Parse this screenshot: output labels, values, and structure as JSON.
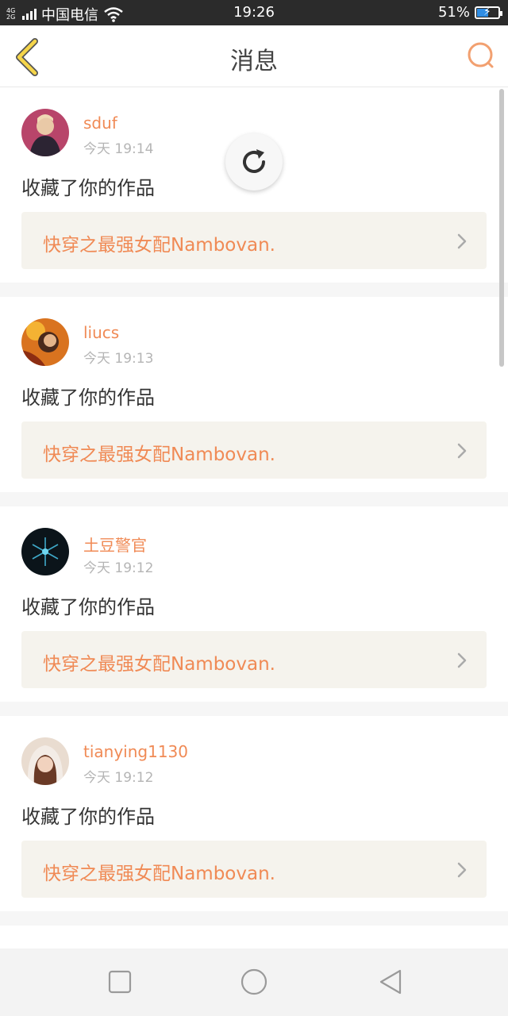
{
  "status_bar": {
    "network_top": "4G",
    "network_bottom": "2G",
    "carrier": "中国电信",
    "time": "19:26",
    "battery": "51%",
    "battery_level": 0.51
  },
  "header": {
    "title": "消息"
  },
  "messages": [
    {
      "username": "sduf",
      "time": "今天 19:14",
      "action": "收藏了你的作品",
      "work": "快穿之最强女配Nambovan.",
      "avatar_color": "#7a3b4a"
    },
    {
      "username": "liucs",
      "time": "今天 19:13",
      "action": "收藏了你的作品",
      "work": "快穿之最强女配Nambovan.",
      "avatar_color": "#c8651e"
    },
    {
      "username": "土豆警官",
      "time": "今天 19:12",
      "action": "收藏了你的作品",
      "work": "快穿之最强女配Nambovan.",
      "avatar_color": "#0e1a22"
    },
    {
      "username": "tianying1130",
      "time": "今天 19:12",
      "action": "收藏了你的作品",
      "work": "快穿之最强女配Nambovan.",
      "avatar_color": "#b5866d"
    }
  ],
  "icons": {
    "back": "chevron-left-icon",
    "search": "search-icon",
    "refresh": "refresh-icon",
    "nav_recent": "square-icon",
    "nav_home": "circle-icon",
    "nav_back": "triangle-back-icon"
  },
  "colors": {
    "accent": "#f08a55",
    "back_arrow": "#f5d54a",
    "link_bg": "#f5f3ed"
  }
}
